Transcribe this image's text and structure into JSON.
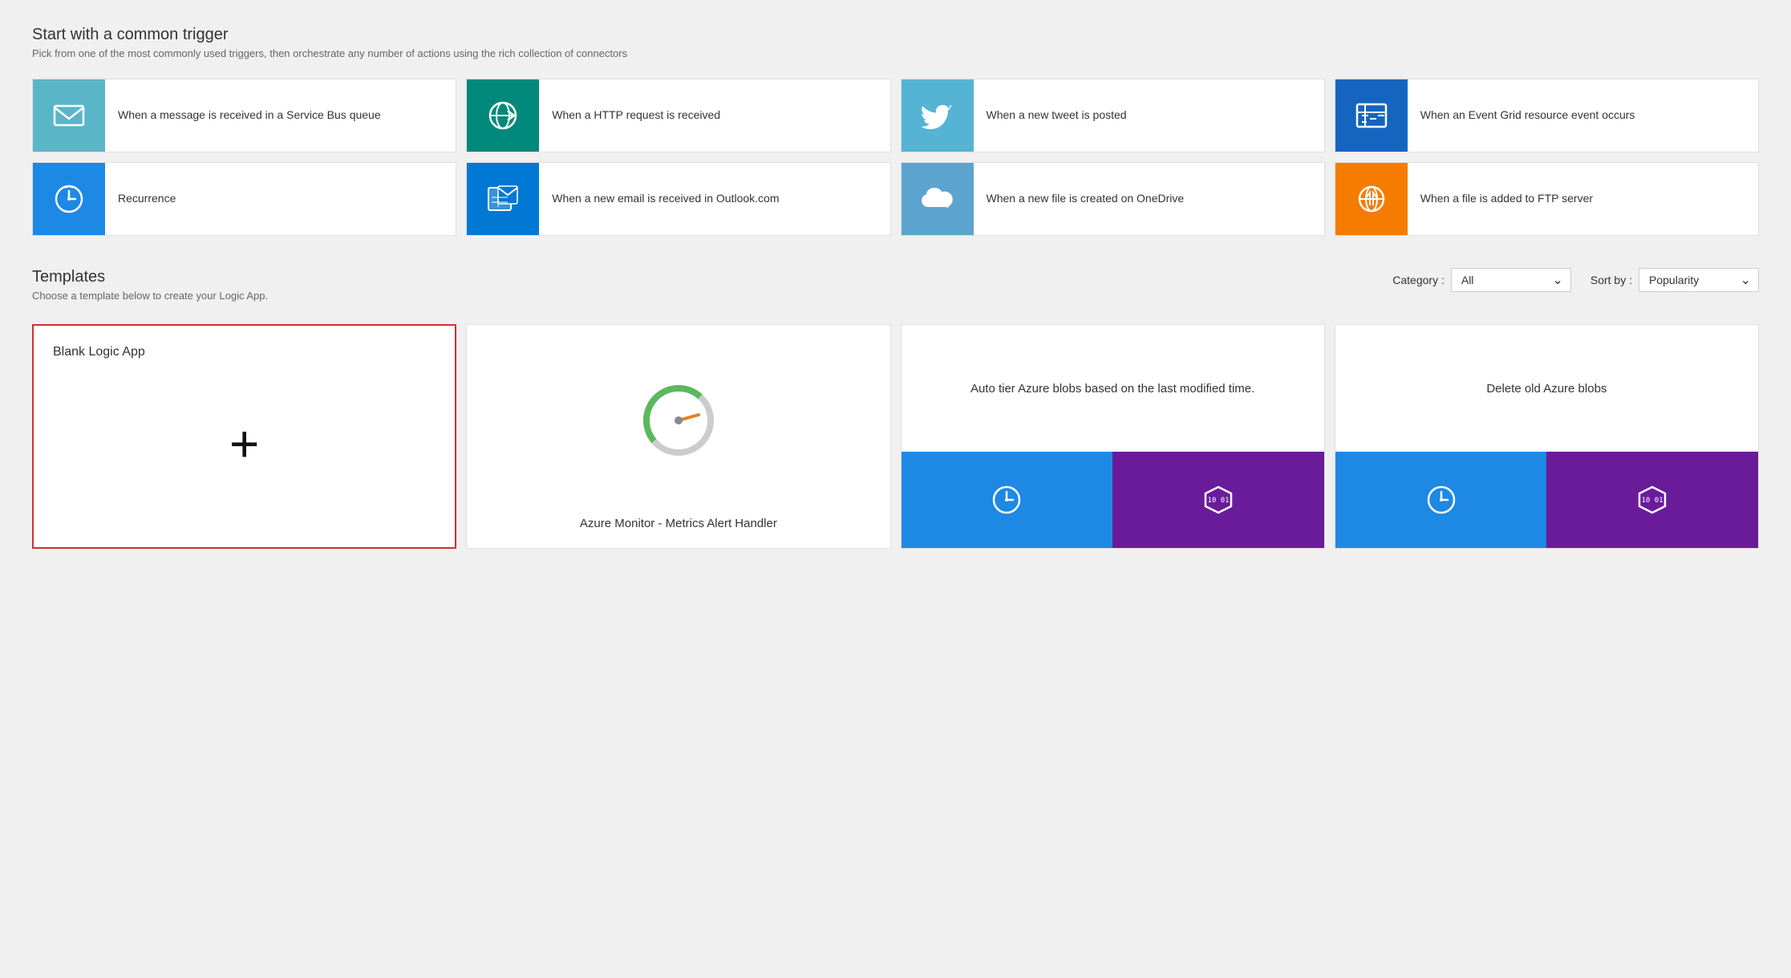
{
  "page": {
    "triggers_section_title": "Start with a common trigger",
    "triggers_section_subtitle": "Pick from one of the most commonly used triggers, then orchestrate any number of actions using the rich collection of connectors",
    "triggers": [
      {
        "id": "service-bus",
        "label": "When a message is received in a Service Bus queue",
        "icon": "✉",
        "bg": "light-blue"
      },
      {
        "id": "http-request",
        "label": "When a HTTP request is received",
        "icon": "🌐",
        "bg": "teal"
      },
      {
        "id": "tweet",
        "label": "When a new tweet is posted",
        "icon": "🐦",
        "bg": "sky-blue"
      },
      {
        "id": "event-grid",
        "label": "When an Event Grid resource event occurs",
        "icon": "⚡",
        "bg": "dark-blue"
      },
      {
        "id": "recurrence",
        "label": "Recurrence",
        "icon": "⏰",
        "bg": "blue"
      },
      {
        "id": "outlook-email",
        "label": "When a new email is received in Outlook.com",
        "icon": "📅",
        "bg": "azure-blue"
      },
      {
        "id": "onedrive",
        "label": "When a new file is created on OneDrive",
        "icon": "☁",
        "bg": "cloud-blue"
      },
      {
        "id": "ftp",
        "label": "When a file is added to FTP server",
        "icon": "🌐",
        "bg": "orange"
      }
    ],
    "templates_section_title": "Templates",
    "templates_section_subtitle": "Choose a template below to create your Logic App.",
    "category_label": "Category :",
    "category_value": "All",
    "sortby_label": "Sort by :",
    "sortby_value": "Popularity",
    "templates": [
      {
        "id": "blank",
        "label": "Blank Logic App",
        "type": "blank",
        "selected": true
      },
      {
        "id": "azure-monitor",
        "label": "Azure Monitor - Metrics Alert Handler",
        "type": "gauge"
      },
      {
        "id": "auto-tier-blobs",
        "label": "Auto tier Azure blobs based on the last modified time.",
        "type": "dual-icon",
        "top_bg": "#1e88e5",
        "bottom_bg": "#6a1b9a",
        "top_icon": "⏰",
        "bottom_icon": "⬡"
      },
      {
        "id": "delete-old-blobs",
        "label": "Delete old Azure blobs",
        "type": "dual-icon",
        "top_bg": "#1e88e5",
        "bottom_bg": "#6a1b9a",
        "top_icon": "⏰",
        "bottom_icon": "⬡"
      }
    ]
  }
}
